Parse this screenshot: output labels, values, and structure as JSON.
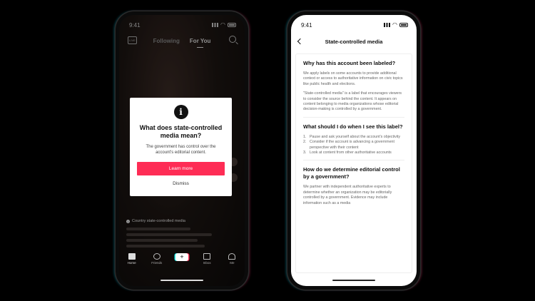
{
  "left_phone": {
    "status_time": "9:41",
    "tabs": [
      "Following",
      "For You"
    ],
    "live_label": "LIVE",
    "modal": {
      "icon": "info-icon",
      "title": "What does state-controlled media mean?",
      "body": "The government has control over the account's editorial content.",
      "primary_button": "Learn more",
      "secondary_button": "Dismiss",
      "primary_color": "#fe2c55"
    },
    "caption": "Country state-controlled media",
    "bottom_nav": [
      {
        "label": "Home",
        "icon": "home-icon"
      },
      {
        "label": "Friends",
        "icon": "friends-icon"
      },
      {
        "label": "",
        "icon": "create-icon"
      },
      {
        "label": "Inbox",
        "icon": "inbox-icon"
      },
      {
        "label": "Me",
        "icon": "profile-icon"
      }
    ]
  },
  "right_phone": {
    "status_time": "9:41",
    "title": "State-controlled media",
    "sections": [
      {
        "heading": "Why has this account been labeled?",
        "paragraphs": [
          "We apply labels on some accounts to provide additional context or access to authoritative information on civic topics like public health and elections.",
          "\"State-controlled media\" is a label that encourages viewers to consider the source behind the content. It appears on content belonging to media organizations whose editorial decision-making is controlled by a government."
        ]
      },
      {
        "heading": "What should I do when I see this label?",
        "list": [
          "Pause and ask yourself about the account's objectivity",
          "Consider if the account is advancing a government perspective with their content",
          "Look at content from other authoritative accounts"
        ]
      },
      {
        "heading": "How do we determine editorial control by a government?",
        "paragraphs": [
          "We partner with independent authoritative experts to determine whether an organization may be editorially controlled by a government. Evidence may include information such as a media"
        ]
      }
    ]
  }
}
